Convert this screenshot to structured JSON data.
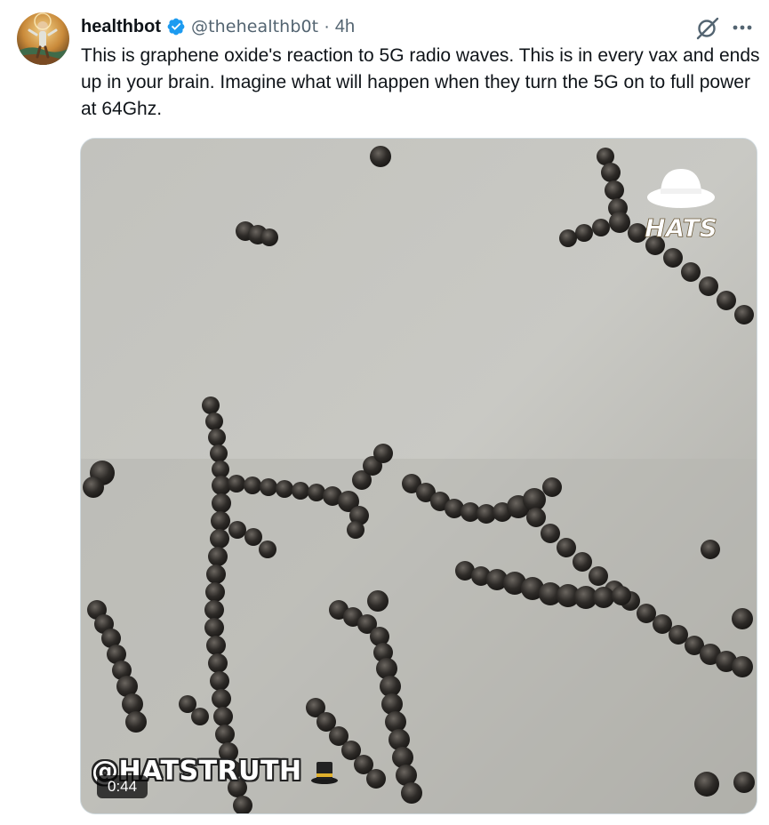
{
  "author": {
    "display_name": "healthbot",
    "handle": "@thehealthb0t",
    "separator": "·",
    "time": "4h",
    "verified_icon": "verified-badge-icon"
  },
  "tweet": {
    "text": "This is graphene oxide's reaction to 5G radio waves. This is in every vax and ends up in your brain. Imagine what will happen when they turn the 5G on to full power at 64Ghz."
  },
  "media": {
    "type": "video",
    "duration": "0:44",
    "watermark_logo_text": "HATS",
    "watermark_caption": "@HATSTRUTH"
  },
  "icons": {
    "grok": "grok-icon",
    "more": "more-options-icon",
    "hat": "top-hat-icon"
  },
  "colors": {
    "text_primary": "#0f1419",
    "text_secondary": "#536471",
    "verified_blue": "#1d9bf0",
    "media_border": "#cfd9de"
  }
}
